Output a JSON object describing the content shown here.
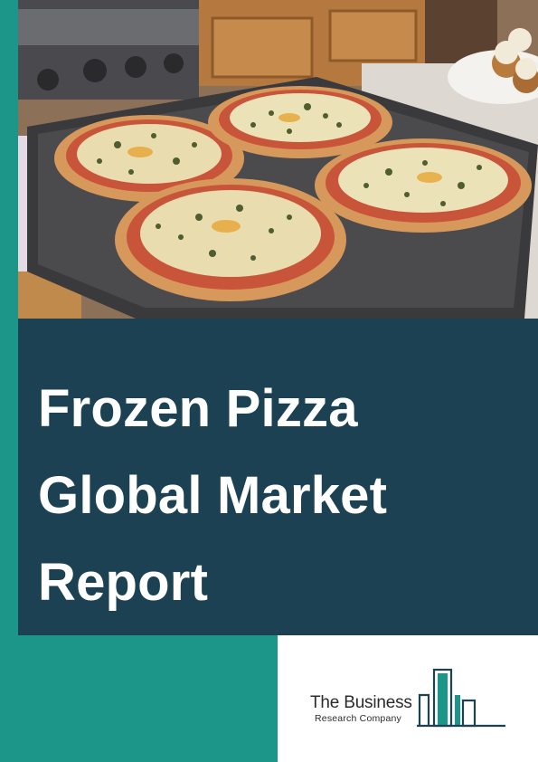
{
  "cover": {
    "title_lines": [
      "Frozen Pizza",
      "Global Market",
      "Report"
    ],
    "colors": {
      "teal": "#1d968a",
      "navy": "#1b4152",
      "white": "#ffffff"
    },
    "image": {
      "subject": "pizza-tray-photo"
    }
  },
  "publisher": {
    "name": "The Business",
    "subtitle": "Research Company",
    "logo_icon": "bar-chart-logo-icon"
  }
}
